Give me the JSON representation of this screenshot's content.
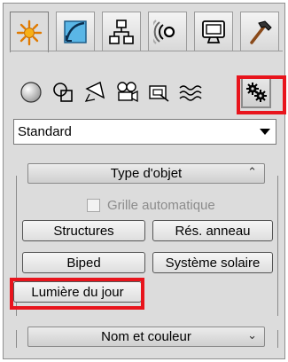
{
  "tabs": [
    {
      "name": "create-tab",
      "icon": "sun-star-icon",
      "active": true
    },
    {
      "name": "modify-tab",
      "icon": "modify-curve-icon",
      "active": false
    },
    {
      "name": "hierarchy-tab",
      "icon": "hierarchy-icon",
      "active": false
    },
    {
      "name": "motion-tab",
      "icon": "motion-rings-icon",
      "active": false
    },
    {
      "name": "display-tab",
      "icon": "display-monitor-icon",
      "active": false
    },
    {
      "name": "utilities-tab",
      "icon": "hammer-icon",
      "active": false
    }
  ],
  "categories": [
    {
      "name": "geometry-icon"
    },
    {
      "name": "shapes-icon"
    },
    {
      "name": "lights-icon"
    },
    {
      "name": "cameras-icon"
    },
    {
      "name": "helpers-icon"
    },
    {
      "name": "space-warps-icon"
    },
    {
      "name": "systems-icon",
      "selected": true
    }
  ],
  "dropdown": {
    "value": "Standard"
  },
  "object_type": {
    "title": "Type d'objet",
    "autogrid_label": "Grille automatique",
    "buttons": {
      "structures": "Structures",
      "ring_array": "Rés. anneau",
      "biped": "Biped",
      "sunlight": "Système solaire",
      "daylight": "Lumière du jour"
    }
  },
  "name_color": {
    "title": "Nom et couleur"
  },
  "colors": {
    "highlight": "#e8141c",
    "panel": "#dcdcdc"
  }
}
